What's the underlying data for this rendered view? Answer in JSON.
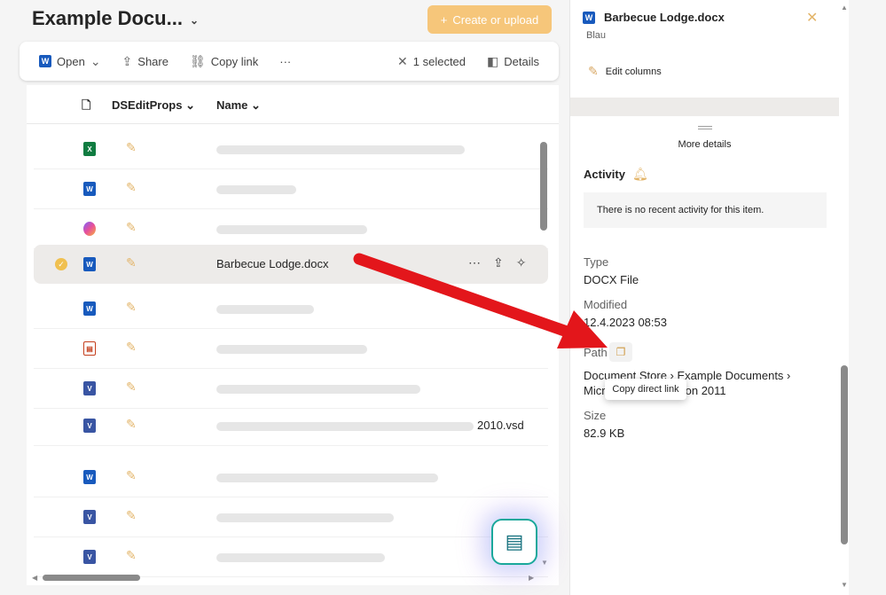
{
  "header": {
    "title": "Example Docu...",
    "create_label": "Create or upload"
  },
  "commandbar": {
    "open": "Open",
    "share": "Share",
    "copy_link": "Copy link",
    "more": "···",
    "selected": "1 selected",
    "details": "Details"
  },
  "list": {
    "columns": {
      "ds": "DSEditProps",
      "name": "Name"
    },
    "rows": [
      {
        "type": "excel",
        "name": "",
        "blur_w": 280
      },
      {
        "type": "word",
        "name": "",
        "blur_w": 90
      },
      {
        "type": "loop",
        "name": "",
        "blur_w": 170
      },
      {
        "type": "word",
        "name": "Barbecue Lodge.docx",
        "selected": true
      },
      {
        "type": "word",
        "name": "",
        "blur_w": 110
      },
      {
        "type": "pdf",
        "name": "",
        "blur_w": 170
      },
      {
        "type": "visio",
        "name": "",
        "blur_w": 230
      },
      {
        "type": "visio",
        "name": "2010.vsd",
        "blur_w": 290
      },
      {
        "type": "word",
        "name": "",
        "blur_w": 250
      },
      {
        "type": "visio",
        "name": "",
        "blur_w": 200
      },
      {
        "type": "visio",
        "name": "",
        "blur_w": 190
      }
    ]
  },
  "panel": {
    "filename": "Barbecue Lodge.docx",
    "cut_text": "Blau",
    "edit_columns": "Edit columns",
    "more_details": "More details",
    "activity_title": "Activity",
    "activity_empty": "There is no recent activity for this item.",
    "type_label": "Type",
    "type_value": "DOCX File",
    "modified_label": "Modified",
    "modified_value": "12.4.2023 08:53",
    "path_label": "Path",
    "path_value": "Document Store › Example Documents › Microsoft Office Lation 2011",
    "tooltip": "Copy direct link",
    "size_label": "Size",
    "size_value": "82.9 KB"
  },
  "colors": {
    "accent": "#f6c67a",
    "word": "#185abd",
    "excel": "#107c41",
    "arrow": "#e3161b"
  }
}
